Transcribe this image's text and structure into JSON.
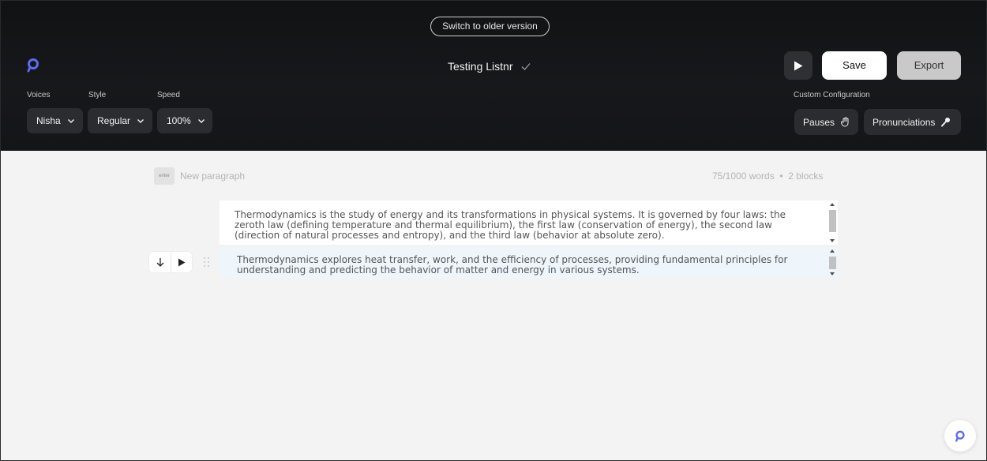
{
  "header": {
    "switch_version_label": "Switch to older version",
    "document_title": "Testing Listnr",
    "save_label": "Save",
    "export_label": "Export",
    "icons": {
      "logo": "listnr-logo-icon",
      "title_status": "check-icon",
      "play": "play-icon"
    }
  },
  "controls": {
    "voices_label": "Voices",
    "voices_value": "Nisha",
    "style_label": "Style",
    "style_value": "Regular",
    "speed_label": "Speed",
    "speed_value": "100%",
    "custom_config_label": "Custom Configuration",
    "pauses_label": "Pauses",
    "pronunciations_label": "Pronunciations"
  },
  "editor": {
    "enter_key_label": "enter",
    "new_paragraph_placeholder": "New paragraph",
    "word_count": "75/1000 words",
    "block_count": "2 blocks",
    "blocks": [
      {
        "text": "Thermodynamics is the study of energy and its transformations in physical systems. It is governed by four laws: the zeroth law (defining temperature and thermal equilibrium), the first law (conservation of energy), the second law (direction of natural processes and entropy), and the third law (behavior at absolute zero)."
      },
      {
        "text": "Thermodynamics explores heat transfer, work, and the efficiency of processes, providing fundamental principles for understanding and predicting the behavior of matter and energy in various systems."
      }
    ]
  },
  "colors": {
    "header_bg": "#141518",
    "accent": "#5b6cf0",
    "active_block_bg": "#eef5fb",
    "page_bg": "#f3f3f3"
  }
}
